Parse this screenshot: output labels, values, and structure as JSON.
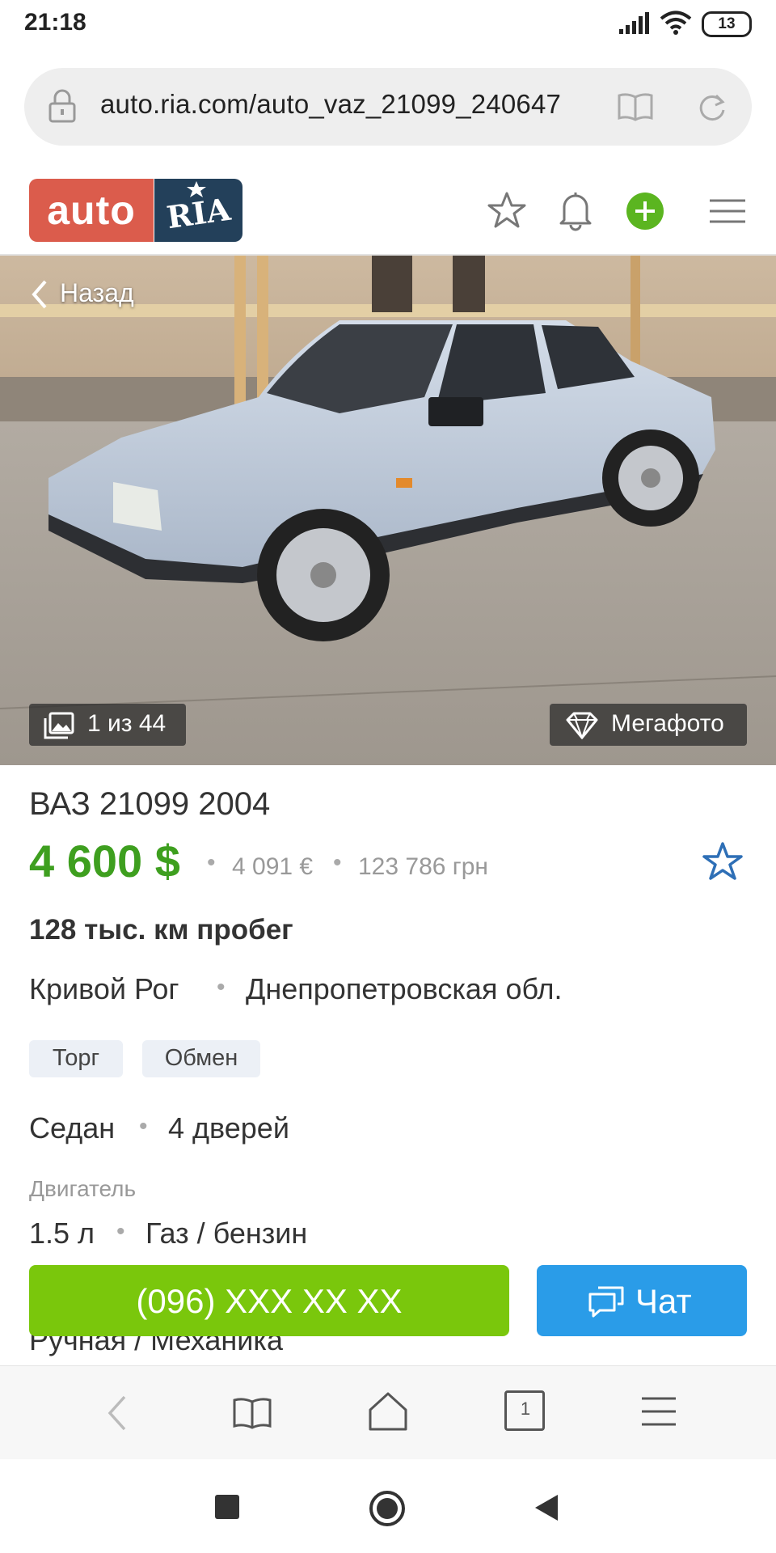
{
  "status_bar": {
    "time": "21:18",
    "battery": "13"
  },
  "browser": {
    "url": "auto.ria.com/auto_vaz_21099_240647",
    "tab_count": "1"
  },
  "header": {
    "logo_auto": "auto",
    "logo_ria": "RIA"
  },
  "photo": {
    "back_label": "Назад",
    "counter": "1 из 44",
    "megafoto_label": "Мегафото"
  },
  "listing": {
    "title": "ВАЗ 21099 2004",
    "price_usd": "4 600 $",
    "price_eur": "4 091 €",
    "price_uah": "123 786 грн",
    "mileage": "128 тыс. км пробег",
    "city": "Кривой Рог",
    "region": "Днепропетровская обл.",
    "tags": [
      "Торг",
      "Обмен"
    ],
    "body_type": "Седан",
    "doors": "4 дверей",
    "engine_label": "Двигатель",
    "engine_volume": "1.5 л",
    "engine_fuel": "Газ / бензин",
    "gearbox": "Ручная / Механика"
  },
  "actions": {
    "call_label": "(096) XXX XX XX",
    "chat_label": "Чат"
  },
  "colors": {
    "price_green": "#3e9f1f",
    "call_green": "#7ac70c",
    "chat_blue": "#2a9ce8",
    "logo_red": "#db5c4c",
    "logo_navy": "#23405a"
  }
}
